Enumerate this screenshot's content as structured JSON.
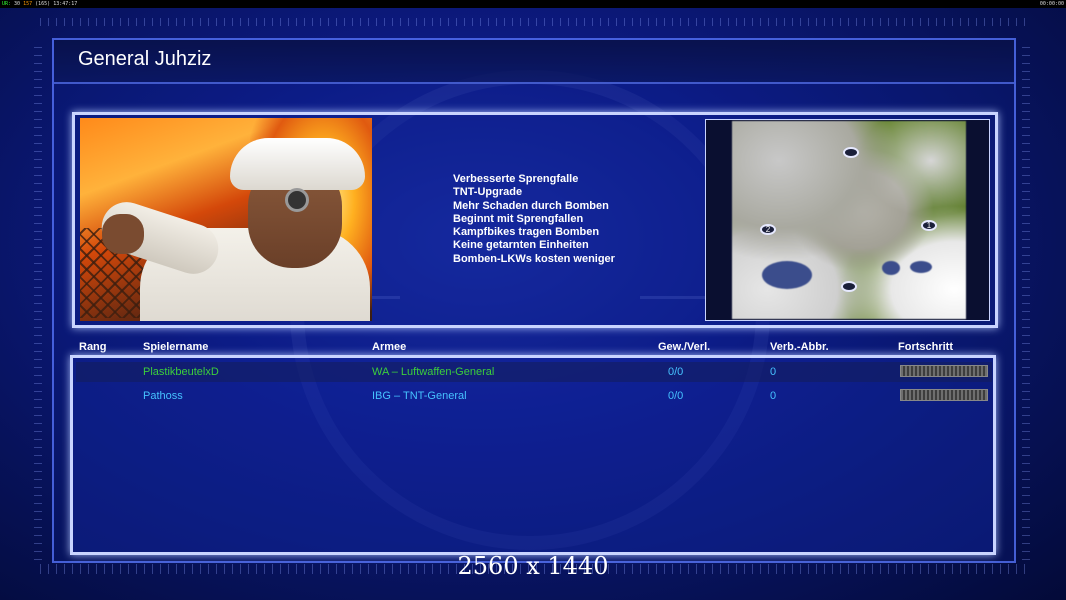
{
  "status_bar": {
    "left_prefix": "UR:",
    "left_fps": "30",
    "left_ping": "157",
    "left_extra": "(165)",
    "left_time": "13:47:17",
    "right_time": "00:00:00"
  },
  "header": {
    "title": "General Juhziz"
  },
  "general": {
    "traits": [
      "Verbesserte Sprengfalle",
      "TNT-Upgrade",
      "Mehr Schaden durch Bomben",
      "Beginnt mit Sprengfallen",
      "Kampfbikes tragen Bomben",
      "Keine getarnten Einheiten",
      "Bomben-LKWs kosten weniger"
    ],
    "portrait_icon": "general-portrait",
    "minimap_icon": "minimap"
  },
  "minimap": {
    "spawns": [
      "",
      "2",
      "1",
      ""
    ]
  },
  "table": {
    "headers": {
      "rank": "Rang",
      "player": "Spielername",
      "army": "Armee",
      "winloss": "Gew./Verl.",
      "destroyed": "Verb.-Abbr.",
      "progress": "Fortschritt"
    },
    "rows": [
      {
        "rank": "",
        "player": "PlastikbeutelxD",
        "army": "WA – Luftwaffen-General",
        "winloss": "0/0",
        "destroyed": "0",
        "progress": 0,
        "color": "#3ccf3c"
      },
      {
        "rank": "",
        "player": "Pathoss",
        "army": "IBG – TNT-General",
        "winloss": "0/0",
        "destroyed": "0",
        "progress": 0,
        "color": "#46c2ff"
      }
    ]
  },
  "overlay": {
    "resolution": "2560 x 1440"
  }
}
